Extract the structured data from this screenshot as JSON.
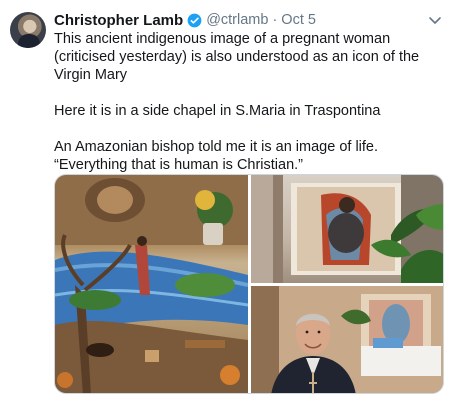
{
  "tweet": {
    "author_name": "Christopher Lamb",
    "handle": "@ctrlamb",
    "separator": "·",
    "date": "Oct 5",
    "text_lines": [
      "This ancient indigenous image of a pregnant woman (criticised yesterday) is also understood as an icon of the Virgin Mary",
      "Here it is in a side chapel in S.Maria in Traspontina",
      "An Amazonian bishop told me it is an image of life. “Everything that is human is Christian.”"
    ]
  },
  "icons": {
    "verified": "verified-badge-icon",
    "more": "chevron-down-icon"
  },
  "colors": {
    "name": "#14171a",
    "secondary": "#657786",
    "verified": "#1da1f2",
    "border": "#ccd6dd"
  }
}
